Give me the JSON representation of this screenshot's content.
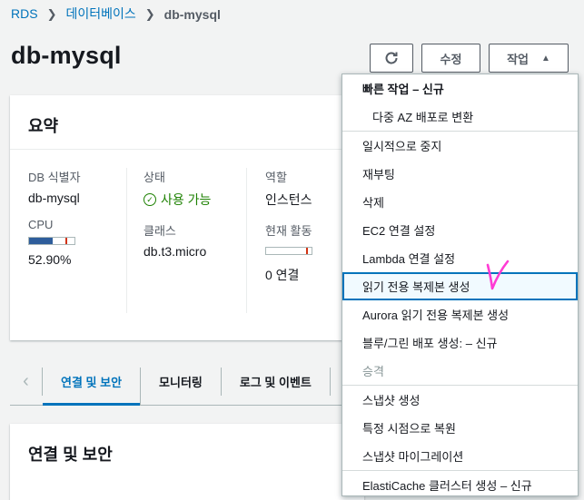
{
  "breadcrumb": {
    "items": [
      "RDS",
      "데이터베이스"
    ],
    "current": "db-mysql",
    "separator": ">"
  },
  "page": {
    "title": "db-mysql"
  },
  "header_buttons": {
    "modify_label": "수정",
    "actions_label": "작업"
  },
  "summary": {
    "title": "요약",
    "db_identifier_label": "DB 식별자",
    "db_identifier_value": "db-mysql",
    "cpu_label": "CPU",
    "cpu_value": "52.90%",
    "cpu_fraction": 0.529,
    "status_label": "상태",
    "status_value": "사용 가능",
    "class_label": "클래스",
    "class_value": "db.t3.micro",
    "role_label": "역할",
    "role_value": "인스턴스",
    "activity_label": "현재 활동",
    "activity_value": "0 연결"
  },
  "tabs": [
    "연결 및 보안",
    "모니터링",
    "로그 및 이벤트"
  ],
  "connection_card": {
    "title": "연결 및 보안"
  },
  "actions_menu": {
    "quick_header": "빠른 작업 – 신규",
    "quick_items": [
      "다중 AZ 배포로 변환"
    ],
    "items": [
      "일시적으로 중지",
      "재부팅",
      "삭제",
      "EC2 연결 설정",
      "Lambda 연결 설정",
      "읽기 전용 복제본 생성",
      "Aurora 읽기 전용 복제본 생성",
      "블루/그린 배포 생성: – 신규",
      "승격"
    ],
    "items2": [
      "스냅샷 생성",
      "특정 시점으로 복원",
      "스냅샷 마이그레이션"
    ],
    "items3": [
      "ElastiCache 클러스터 생성 – 신규"
    ],
    "highlighted": "읽기 전용 복제본 생성",
    "disabled": "승격"
  },
  "colors": {
    "link": "#0073bb",
    "success": "#1d8102",
    "highlight_border": "#0073bb",
    "annotation": "#ff3bd4"
  }
}
